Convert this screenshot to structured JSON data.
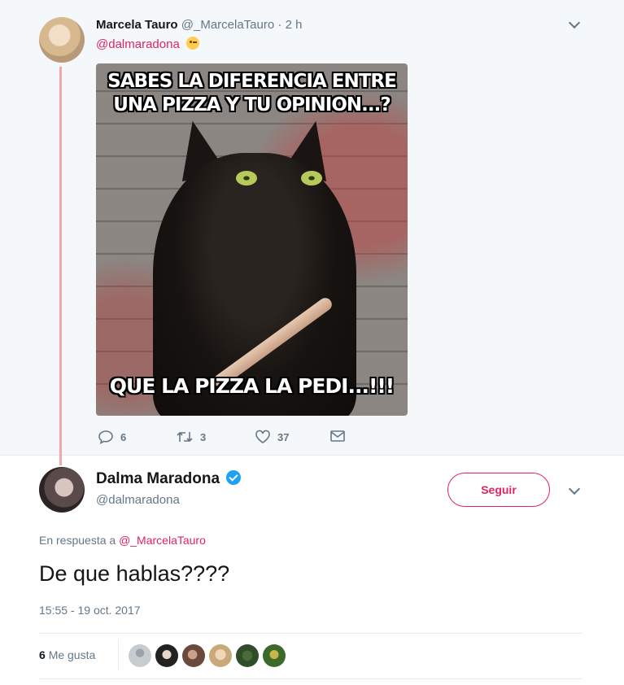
{
  "parent_tweet": {
    "name": "Marcela Tauro",
    "handle": "@_MarcelaTauro",
    "separator": "·",
    "time": "2 h",
    "reply_to": "@dalmaradona",
    "meme": {
      "top_text": "SABES LA DIFERENCIA ENTRE UNA PIZZA Y TU OPINION...?",
      "bottom_text": "QUE LA PIZZA LA PEDI...!!!"
    },
    "actions": {
      "replies": "6",
      "retweets": "3",
      "likes": "37"
    }
  },
  "main_tweet": {
    "name": "Dalma Maradona",
    "handle": "@dalmaradona",
    "follow_label": "Seguir",
    "in_reply_prefix": "En respuesta a",
    "in_reply_mention": "@_MarcelaTauro",
    "text": "De que hablas????",
    "timestamp": "15:55 - 19 oct. 2017",
    "likes_count": "6",
    "likes_label": "Me gusta"
  },
  "icons": {
    "reply": "reply-icon",
    "retweet": "retweet-icon",
    "like": "heart-icon",
    "dm": "envelope-icon",
    "verified": "verified-icon",
    "more": "chevron-down-icon"
  },
  "colors": {
    "accent": "#e0245e",
    "verified": "#1da1f2",
    "muted": "#657786",
    "thread_line": "#f4a6ad"
  }
}
